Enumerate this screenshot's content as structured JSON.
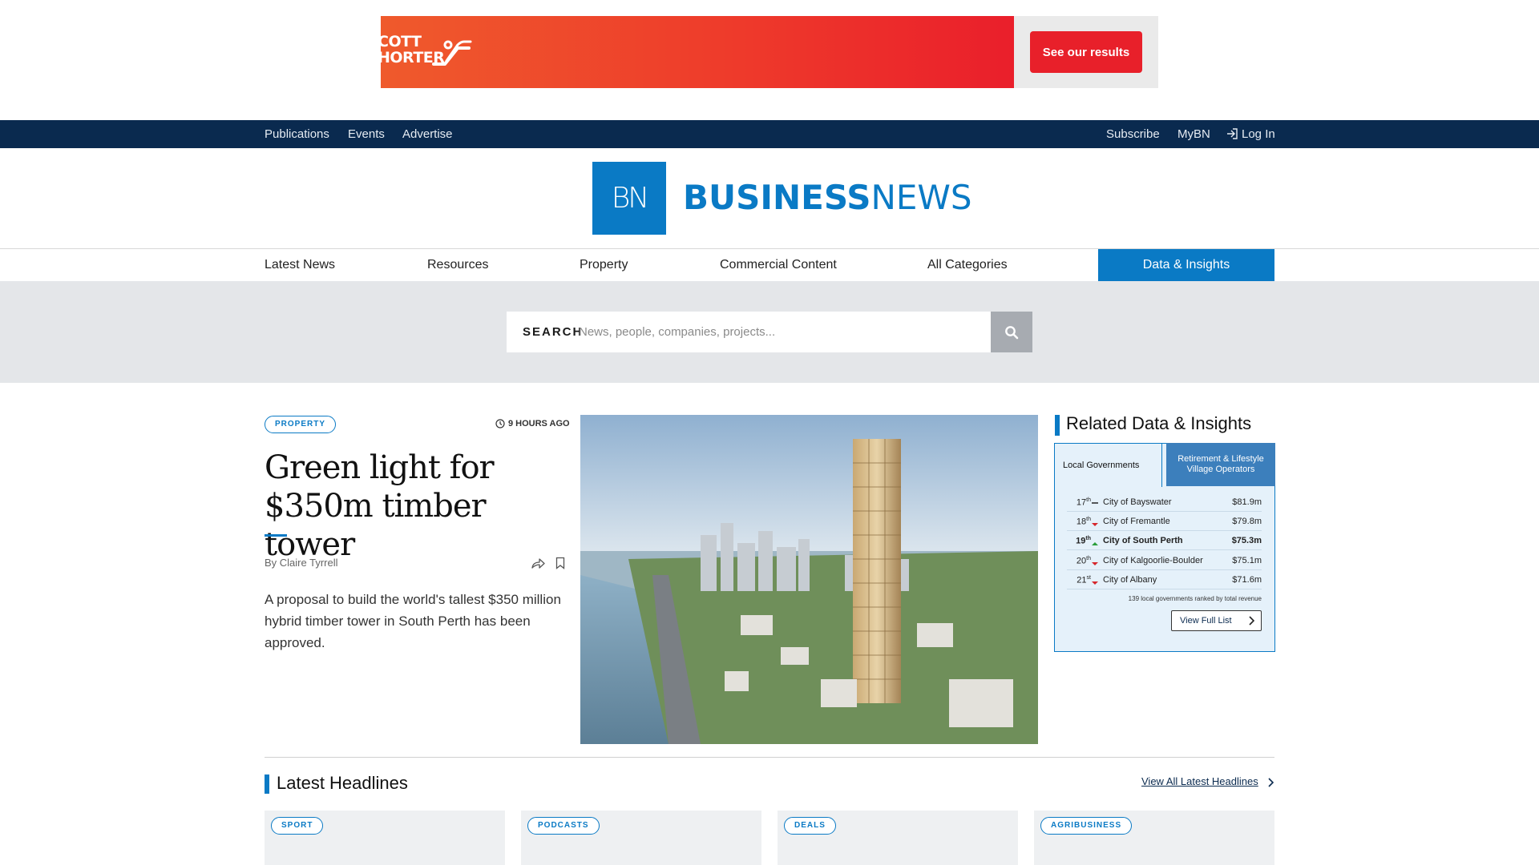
{
  "ad": {
    "brand_line1": "COTT",
    "brand_line2": "HORTER",
    "cta_label": "See our results",
    "colors": {
      "gradient_start": "#ef5a2c",
      "gradient_end": "#ea1f2b",
      "cta": "#e8202a"
    }
  },
  "topbar": {
    "left_links": [
      "Publications",
      "Events",
      "Advertise"
    ],
    "subscribe": "Subscribe",
    "mybn": "MyBN",
    "login": "Log In",
    "login_icon": "login-arrow-icon",
    "color": "#0a2a4f"
  },
  "logo": {
    "mark": "BN",
    "word_bold": "BUSINESS",
    "word_regular": "NEWS",
    "color": "#0a7ac5"
  },
  "mainnav": {
    "items": [
      "Latest News",
      "Resources",
      "Property",
      "Commercial Content",
      "All Categories"
    ],
    "highlight": "Data & Insights",
    "highlight_color": "#0a7ac5"
  },
  "search": {
    "label": "SEARCH",
    "placeholder": "News, people, companies, projects...",
    "button_icon": "search-icon"
  },
  "feature": {
    "category": "PROPERTY",
    "time": "9 HOURS AGO",
    "title": "Green light for $350m timber tower",
    "byline": "By Claire Tyrrell",
    "summary": "A proposal to build the world's tallest $350 million hybrid timber tower in South Perth has been approved."
  },
  "related": {
    "title": "Related Data & Insights",
    "tab_active": "Local Governments",
    "tab_other": "Retirement & Lifestyle Village Operators",
    "rows": [
      {
        "rank": "17",
        "suffix": "th",
        "trend": "same",
        "name": "City of Bayswater",
        "value": "$81.9m"
      },
      {
        "rank": "18",
        "suffix": "th",
        "trend": "down",
        "name": "City of Fremantle",
        "value": "$79.8m"
      },
      {
        "rank": "19",
        "suffix": "th",
        "trend": "up",
        "name": "City of South Perth",
        "value": "$75.3m"
      },
      {
        "rank": "20",
        "suffix": "th",
        "trend": "down",
        "name": "City of Kalgoorlie-Boulder",
        "value": "$75.1m"
      },
      {
        "rank": "21",
        "suffix": "st",
        "trend": "down",
        "name": "City of Albany",
        "value": "$71.6m"
      }
    ],
    "note": "139 local governments ranked by total revenue",
    "button": "View Full List",
    "colors": {
      "up": "#2a9d3a",
      "down": "#d6262b"
    }
  },
  "latest": {
    "title": "Latest Headlines",
    "view_all": "View All Latest Headlines",
    "cards": [
      "SPORT",
      "PODCASTS",
      "DEALS",
      "AGRIBUSINESS"
    ]
  }
}
